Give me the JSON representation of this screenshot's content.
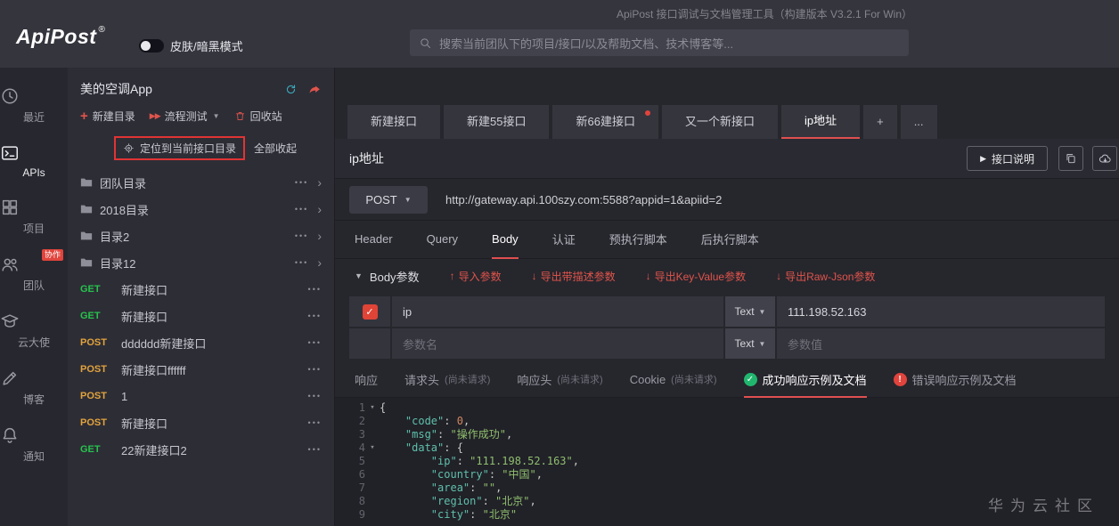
{
  "header": {
    "window_title": "ApiPost 接口调试与文档管理工具（构建版本 V3.2.1 For Win）",
    "logo_text": "ApiPost",
    "logo_reg": "®",
    "theme_toggle_label": "皮肤/暗黑模式",
    "search_placeholder": "搜索当前团队下的项目/接口/以及帮助文档、技术博客等..."
  },
  "nav": {
    "items": [
      {
        "id": "recent",
        "icon": "clock-icon",
        "label": "最近"
      },
      {
        "id": "apis",
        "icon": "terminal-icon",
        "label": "APIs",
        "active": true
      },
      {
        "id": "projects",
        "icon": "grid-icon",
        "label": "项目"
      },
      {
        "id": "team",
        "icon": "team-icon",
        "label": "团队",
        "badge": "协作"
      },
      {
        "id": "ambassador",
        "icon": "ambassador-icon",
        "label": "云大使"
      },
      {
        "id": "blog",
        "icon": "pencil-icon",
        "label": "博客"
      },
      {
        "id": "notice",
        "icon": "bell-icon",
        "label": "通知"
      }
    ]
  },
  "sidebar": {
    "project_name": "美的空调App",
    "new_dir_label": "新建目录",
    "flow_test_label": "流程测试",
    "recycle_label": "回收站",
    "locate_label": "定位到当前接口目录",
    "collapse_all_label": "全部收起",
    "folders": [
      {
        "name": "团队目录"
      },
      {
        "name": "2018目录"
      },
      {
        "name": "目录2"
      },
      {
        "name": "目录12"
      }
    ],
    "apis": [
      {
        "method": "GET",
        "name": "新建接口"
      },
      {
        "method": "GET",
        "name": "新建接口"
      },
      {
        "method": "POST",
        "name": "dddddd新建接口"
      },
      {
        "method": "POST",
        "name": "新建接口ffffff"
      },
      {
        "method": "POST",
        "name": "1"
      },
      {
        "method": "POST",
        "name": "新建接口"
      },
      {
        "method": "GET",
        "name": "22新建接口2"
      }
    ]
  },
  "workspace": {
    "tabs": [
      {
        "label": "新建接口"
      },
      {
        "label": "新建55接口"
      },
      {
        "label": "新66建接口",
        "unsaved_dot": true
      },
      {
        "label": "又一个新接口"
      },
      {
        "label": "ip地址",
        "active": true
      }
    ],
    "new_tab_label": "+",
    "more_tabs_label": "...",
    "api_title": "ip地址",
    "doc_button_label": "接口说明",
    "request": {
      "method": "POST",
      "url": "http://gateway.api.100szy.com:5588?appid=1&apiid=2"
    },
    "request_tabs": [
      {
        "label": "Header"
      },
      {
        "label": "Query"
      },
      {
        "label": "Body",
        "active": true
      },
      {
        "label": "认证"
      },
      {
        "label": "预执行脚本"
      },
      {
        "label": "后执行脚本"
      }
    ],
    "body_panel": {
      "title": "Body参数",
      "import_label": "导入参数",
      "export_desc_label": "导出带描述参数",
      "export_kv_label": "导出Key-Value参数",
      "export_raw_label": "导出Raw-Json参数"
    },
    "params": [
      {
        "checked": true,
        "name": "ip",
        "type": "Text",
        "value": "111.198.52.163"
      },
      {
        "name_placeholder": "参数名",
        "type": "Text",
        "value_placeholder": "参数值"
      }
    ],
    "response_tabs": [
      {
        "label": "响应"
      },
      {
        "label": "请求头",
        "note": "(尚未请求)"
      },
      {
        "label": "响应头",
        "note": "(尚未请求)"
      },
      {
        "label": "Cookie",
        "note": "(尚未请求)"
      },
      {
        "label": "成功响应示例及文档",
        "status_icon": "success",
        "active": true
      },
      {
        "label": "错误响应示例及文档",
        "status_icon": "error"
      }
    ],
    "response_code": {
      "lines": [
        {
          "n": 1,
          "fold": true,
          "text": "{"
        },
        {
          "n": 2,
          "text": "    \"code\": 0,"
        },
        {
          "n": 3,
          "text": "    \"msg\": \"操作成功\","
        },
        {
          "n": 4,
          "fold": true,
          "text": "    \"data\": {"
        },
        {
          "n": 5,
          "text": "        \"ip\": \"111.198.52.163\","
        },
        {
          "n": 6,
          "text": "        \"country\": \"中国\","
        },
        {
          "n": 7,
          "text": "        \"area\": \"\","
        },
        {
          "n": 8,
          "text": "        \"region\": \"北京\","
        },
        {
          "n": 9,
          "text": "        \"city\": \"北京\""
        }
      ]
    }
  },
  "watermark": "华为云社区",
  "colors": {
    "accent_red": "#e0544b",
    "active_underline": "#e04f4f",
    "get_green": "#27c24c",
    "post_orange": "#e2a33c",
    "success_green": "#21b66e",
    "error_red": "#e0443c"
  }
}
